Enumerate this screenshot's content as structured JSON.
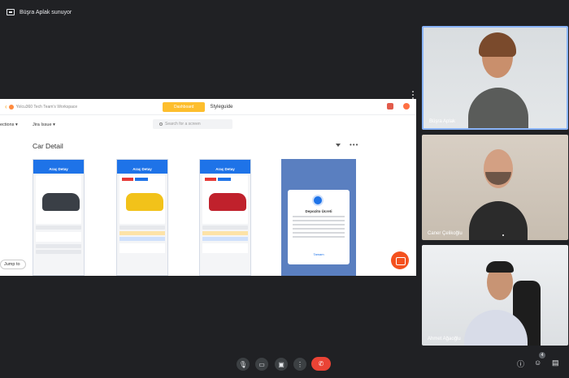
{
  "meeting": {
    "presenter_banner": "Büşra Aplak sunuyor"
  },
  "zeplin": {
    "back_chevron": "‹",
    "workspace": "Yolcu360 Tech Team's Workspace",
    "tabs": {
      "dashboard": "Dashboard",
      "styleguide": "Styleguide"
    },
    "sections_label": "ections ▾",
    "jira_label": "Jira Issue ▾",
    "search_placeholder": "Search for a screen",
    "section_title": "Car Detail",
    "more_label": "•••",
    "screens": [
      {
        "header": "Araç Detay",
        "car_color": "#3a3f46"
      },
      {
        "header": "Araç Detay",
        "car_color": "#f2c21a"
      },
      {
        "header": "Araç Detay",
        "car_color": "#c0212c"
      }
    ],
    "modal": {
      "title": "Depozito Ücreti",
      "button": "Tamam"
    },
    "jump_label": "Jump to"
  },
  "participants": [
    {
      "name": "Büşra Aplak",
      "active": true
    },
    {
      "name": "Caner Çelikoğlu",
      "active": false
    },
    {
      "name": "Ahmet Ağaoğlu",
      "active": false
    }
  ],
  "controls": {
    "mic_icon": "mic-icon",
    "camera_icon": "camera-icon",
    "present_icon": "present-icon",
    "more_icon": "more-vert-icon",
    "end_call_icon": "end-call-icon",
    "participant_count": "4"
  }
}
